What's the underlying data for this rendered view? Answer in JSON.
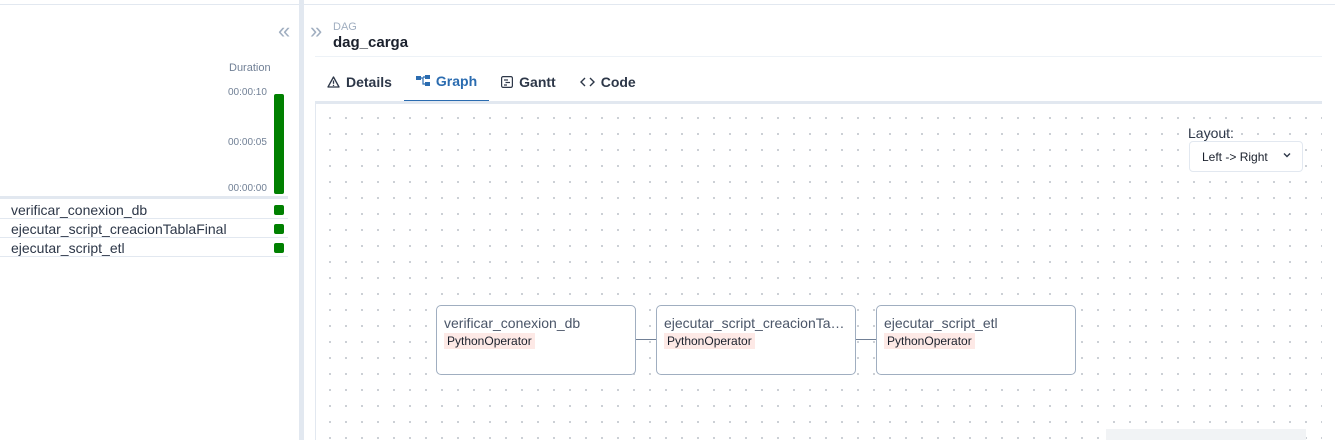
{
  "grid": {
    "collapse_glyph": "«",
    "duration_label": "Duration",
    "ticks": [
      "00:00:10",
      "00:00:05",
      "00:00:00"
    ],
    "run_duration_fraction": 1.0,
    "status_color": "#008000",
    "tasks": [
      {
        "label": "verificar_conexion_db"
      },
      {
        "label": "ejecutar_script_creacionTablaFinal"
      },
      {
        "label": "ejecutar_script_etl"
      }
    ]
  },
  "header": {
    "expand_glyph": "»",
    "dag_label": "DAG",
    "dag_name": "dag_carga"
  },
  "tabs": [
    {
      "label": "Details",
      "icon": "warning-triangle-icon"
    },
    {
      "label": "Graph",
      "icon": "graph-icon",
      "active": true
    },
    {
      "label": "Gantt",
      "icon": "gantt-icon"
    },
    {
      "label": "Code",
      "icon": "code-icon"
    }
  ],
  "graph": {
    "layout_label": "Layout:",
    "layout_value": "Left -> Right",
    "nodes": [
      {
        "name": "verificar_conexion_db",
        "operator": "PythonOperator"
      },
      {
        "name": "ejecutar_script_creacionTa…",
        "operator": "PythonOperator"
      },
      {
        "name": "ejecutar_script_etl",
        "operator": "PythonOperator"
      }
    ]
  },
  "colors": {
    "accent": "#2b6cb0",
    "success": "#008000",
    "operator_bg": "#fde9e6"
  }
}
